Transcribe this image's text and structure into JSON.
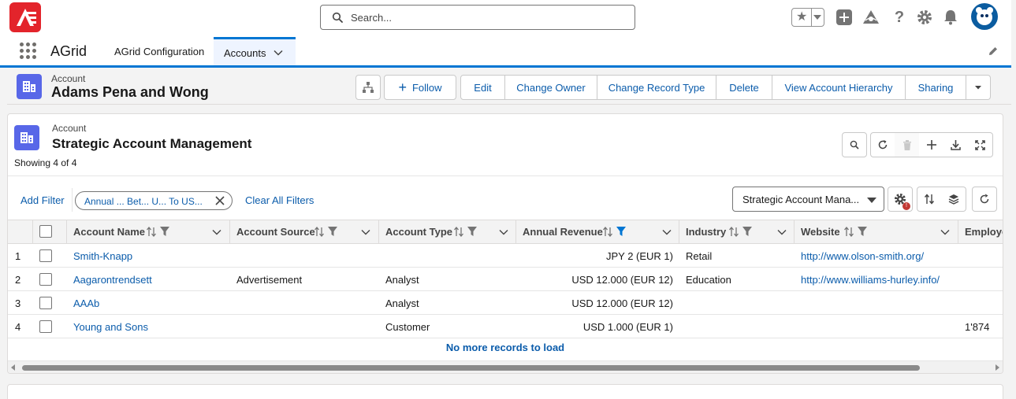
{
  "header": {
    "search_placeholder": "Search...",
    "icons": [
      "star-icon",
      "add-icon",
      "trailhead-icon",
      "help-icon",
      "setup-gear-icon",
      "notifications-bell-icon",
      "avatar"
    ]
  },
  "nav": {
    "app_name": "AGrid",
    "items": [
      {
        "label": "AGrid Configuration"
      },
      {
        "label": "Accounts",
        "active": true
      }
    ]
  },
  "record": {
    "object_type": "Account",
    "title": "Adams Pena and Wong",
    "actions": {
      "follow": "Follow",
      "edit": "Edit",
      "change_owner": "Change Owner",
      "change_record_type": "Change Record Type",
      "delete": "Delete",
      "view_hierarchy": "View Account Hierarchy",
      "sharing": "Sharing"
    }
  },
  "grid": {
    "object_type": "Account",
    "title": "Strategic Account Management",
    "count_text": "Showing 4 of 4",
    "add_filter": "Add Filter",
    "filter_pill": "Annual ... Bet... U... To US...",
    "clear_filters": "Clear All Filters",
    "view_selected": "Strategic Account Mana...",
    "settings_badge": "!",
    "columns": [
      "Account Name",
      "Account Source",
      "Account Type",
      "Annual Revenue",
      "Industry",
      "Website",
      "Employe"
    ],
    "rows": [
      {
        "num": "1",
        "name": "Smith-Knapp",
        "source": "",
        "type": "",
        "revenue": "JPY 2 (EUR 1)",
        "industry": "Retail",
        "website": "http://www.olson-smith.org/",
        "employees": ""
      },
      {
        "num": "2",
        "name": "Aagarontrendsett",
        "source": "Advertisement",
        "type": "Analyst",
        "revenue": "USD 12.000 (EUR 12)",
        "industry": "Education",
        "website": "http://www.williams-hurley.info/",
        "employees": ""
      },
      {
        "num": "3",
        "name": "AAAb",
        "source": "",
        "type": "Analyst",
        "revenue": "USD 12.000 (EUR 12)",
        "industry": "",
        "website": "",
        "employees": ""
      },
      {
        "num": "4",
        "name": "Young and Sons",
        "source": "",
        "type": "Customer",
        "revenue": "USD 1.000 (EUR 1)",
        "industry": "",
        "website": "",
        "employees": "1'874"
      }
    ],
    "footer": "No more records to load"
  },
  "colors": {
    "brand_blue": "#0176d3",
    "link_blue": "#0b5cab",
    "account_icon": "#5867e8",
    "logo_red": "#e3242b"
  }
}
